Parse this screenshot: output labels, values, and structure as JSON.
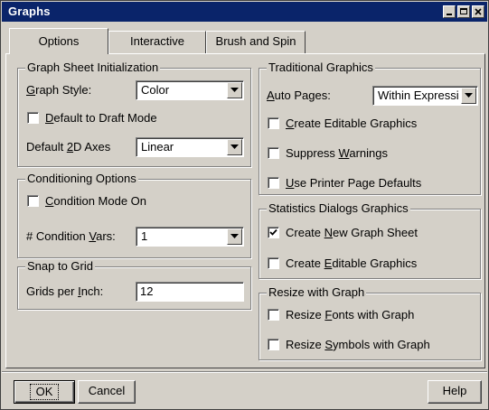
{
  "window": {
    "title": "Graphs"
  },
  "tabs": [
    {
      "label": "Options",
      "active": true
    },
    {
      "label": "Interactive",
      "active": false
    },
    {
      "label": "Brush and Spin",
      "active": false
    }
  ],
  "graph_sheet_init": {
    "title": "Graph Sheet Initialization",
    "graph_style_label": "Graph Style:",
    "graph_style_value": "Color",
    "default_draft_label": "Default to Draft Mode",
    "default_draft_checked": false,
    "default_2d_axes_label": "Default 2D Axes",
    "default_2d_axes_value": "Linear"
  },
  "conditioning": {
    "title": "Conditioning Options",
    "condition_mode_label": "Condition Mode On",
    "condition_mode_checked": false,
    "condition_vars_label": "# Condition Vars:",
    "condition_vars_value": "1"
  },
  "snap": {
    "title": "Snap to Grid",
    "grids_label": "Grids per Inch:",
    "grids_value": "12"
  },
  "traditional": {
    "title": "Traditional Graphics",
    "auto_pages_label": "Auto Pages:",
    "auto_pages_value": "Within Expressi",
    "create_editable_label": "Create Editable Graphics",
    "create_editable_checked": false,
    "suppress_warnings_label": "Suppress Warnings",
    "suppress_warnings_checked": false,
    "printer_defaults_label": "Use Printer Page Defaults",
    "printer_defaults_checked": false
  },
  "statistics": {
    "title": "Statistics Dialogs Graphics",
    "new_graph_sheet_label": "Create New Graph Sheet",
    "new_graph_sheet_checked": true,
    "create_editable_label": "Create Editable Graphics",
    "create_editable_checked": false
  },
  "resize": {
    "title": "Resize with Graph",
    "fonts_label": "Resize Fonts with Graph",
    "fonts_checked": false,
    "symbols_label": "Resize Symbols with Graph",
    "symbols_checked": false
  },
  "buttons": {
    "ok": "OK",
    "cancel": "Cancel",
    "help": "Help"
  },
  "colors": {
    "titlebar": "#0a246a",
    "face": "#d4d0c8"
  }
}
